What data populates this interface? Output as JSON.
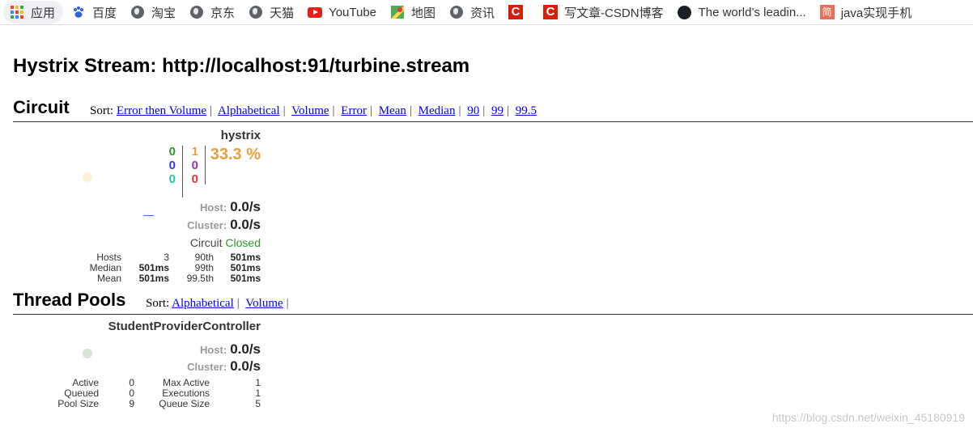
{
  "bookmarks": [
    {
      "label": "应用",
      "icon": "apps-grid-icon"
    },
    {
      "label": "百度",
      "icon": "baidu-paw-icon"
    },
    {
      "label": "淘宝",
      "icon": "globe-icon"
    },
    {
      "label": "京东",
      "icon": "globe-icon"
    },
    {
      "label": "天猫",
      "icon": "globe-icon"
    },
    {
      "label": "YouTube",
      "icon": "youtube-icon"
    },
    {
      "label": "地图",
      "icon": "maps-icon"
    },
    {
      "label": "资讯",
      "icon": "globe-icon"
    },
    {
      "label": "",
      "icon": "csdn-icon"
    },
    {
      "label": "写文章-CSDN博客",
      "icon": "csdn-icon"
    },
    {
      "label": "The world’s leadin...",
      "icon": "github-icon"
    },
    {
      "label": "java实现手机",
      "icon": "jianshu-icon"
    }
  ],
  "page": {
    "title": "Hystrix Stream: http://localhost:91/turbine.stream"
  },
  "circuit_section": {
    "title": "Circuit",
    "sort_label": "Sort:",
    "sort_links": [
      "Error then Volume",
      "Alphabetical",
      "Volume",
      "Error",
      "Mean",
      "Median",
      "90",
      "99",
      "99.5"
    ]
  },
  "circuit": {
    "name": "hystrix",
    "counts_left": [
      "0",
      "0",
      "0"
    ],
    "counts_right": [
      "1",
      "0",
      "0"
    ],
    "error_rate": "33.3 %",
    "host_label": "Host:",
    "host_rate": "0.0/s",
    "cluster_label": "Cluster:",
    "cluster_rate": "0.0/s",
    "status_label": "Circuit",
    "status_value": "Closed",
    "stats": {
      "hosts_label": "Hosts",
      "hosts": "3",
      "median_label": "Median",
      "median": "501ms",
      "mean_label": "Mean",
      "mean": "501ms",
      "p90_label": "90th",
      "p90": "501ms",
      "p99_label": "99th",
      "p99": "501ms",
      "p995_label": "99.5th",
      "p995": "501ms"
    },
    "colors": {
      "health_dot": "#fdf0d5",
      "success": "#2d9a2d",
      "error_rate": "#e8a13a"
    }
  },
  "thread_section": {
    "title": "Thread Pools",
    "sort_label": "Sort:",
    "sort_links": [
      "Alphabetical",
      "Volume"
    ]
  },
  "thread_pool": {
    "name": "StudentProviderController",
    "host_label": "Host:",
    "host_rate": "0.0/s",
    "cluster_label": "Cluster:",
    "cluster_rate": "0.0/s",
    "stats": {
      "active_label": "Active",
      "active": "0",
      "queued_label": "Queued",
      "queued": "0",
      "pool_size_label": "Pool Size",
      "pool_size": "9",
      "max_active_label": "Max Active",
      "max_active": "1",
      "executions_label": "Executions",
      "executions": "1",
      "queue_size_label": "Queue Size",
      "queue_size": "5"
    },
    "colors": {
      "health_dot": "#d6e3d6"
    }
  },
  "watermark": "https://blog.csdn.net/weixin_45180919"
}
